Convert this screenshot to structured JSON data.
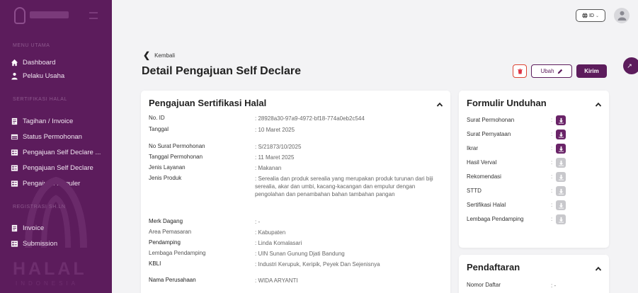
{
  "sidebar": {
    "section_main": "MENU UTAMA",
    "section_cert": "SERTIFIKASI HALAL",
    "section_reg": "REGISTRASI SH.LN",
    "items": [
      {
        "label": "Dashboard",
        "icon": "home-icon"
      },
      {
        "label": "Pelaku Usaha",
        "icon": "user-tie-icon"
      },
      {
        "label": "Tagihan / Invoice",
        "icon": "receipt-icon"
      },
      {
        "label": "Status Permohonan",
        "icon": "table-icon"
      },
      {
        "label": "Pengajuan Self Declare ...",
        "icon": "form-icon"
      },
      {
        "label": "Pengajuan Self Declare",
        "icon": "form-icon"
      },
      {
        "label": "Pengajuan Reguler",
        "icon": "form-icon"
      },
      {
        "label": "Invoice",
        "icon": "receipt-icon"
      },
      {
        "label": "Submission",
        "icon": "form-icon"
      }
    ],
    "logo_text_1": "HALAL",
    "logo_text_2": "INDONESIA"
  },
  "header": {
    "lang_label": "ID",
    "back_label": "Kembali",
    "page_title": "Detail Pengajuan Self Declare",
    "edit_label": "Ubah",
    "send_label": "Kirim"
  },
  "main_card": {
    "title": "Pengajuan Sertifikasi Halal",
    "rows": [
      {
        "label": "No. ID",
        "value": ": 28928a30-97a9-4972-bf18-774a0eb2c544"
      },
      {
        "label": "Tanggal",
        "value": ": 10 Maret 2025"
      },
      {
        "label": "No Surat Permohonan",
        "value": ": S/21873/10/2025"
      },
      {
        "label": "Tanggal Permohonan",
        "value": ": 11 Maret 2025"
      },
      {
        "label": "Jenis Layanan",
        "value": ": Makanan"
      },
      {
        "label": "Jenis Produk",
        "value": ": Serealia dan produk serealia yang merupakan produk turunan dari biji serealia, akar dan umbi, kacang-kacangan dan empulur dengan pengolahan dan penambahan bahan tambahan pangan"
      },
      {
        "label": "Merk Dagang",
        "value": ": -"
      },
      {
        "label": "Area Pemasaran",
        "value": ": Kabupaten"
      },
      {
        "label": "Pendamping",
        "value": ": Linda Komalasari"
      },
      {
        "label": "Lembaga Pendamping",
        "value": ": UIN Sunan Gunung Djati Bandung"
      },
      {
        "label": "KBLI",
        "value": ": Industri Kerupuk, Keripik, Peyek Dan Sejenisnya"
      },
      {
        "label": "Nama Perusahaan",
        "value": ": WIDA ARYANTI"
      }
    ]
  },
  "download_card": {
    "title": "Formulir Unduhan",
    "colon": ":",
    "items": [
      {
        "label": "Surat Permohonan",
        "enabled": true
      },
      {
        "label": "Surat Pernyataan",
        "enabled": true
      },
      {
        "label": "Ikrar",
        "enabled": true
      },
      {
        "label": "Hasil Verval",
        "enabled": false
      },
      {
        "label": "Rekomendasi",
        "enabled": false
      },
      {
        "label": "STTD",
        "enabled": false
      },
      {
        "label": "Sertifikasi Halal",
        "enabled": false
      },
      {
        "label": "Lembaga Pendamping",
        "enabled": false
      }
    ]
  },
  "registration_card": {
    "title": "Pendaftaran",
    "rows": [
      {
        "label": "Nomor Daftar",
        "value": ": -"
      }
    ]
  },
  "colors": {
    "brand": "#5c1c5c",
    "danger": "#dd3344",
    "download_on": "#6a2468",
    "download_off": "#c8c8cc"
  }
}
